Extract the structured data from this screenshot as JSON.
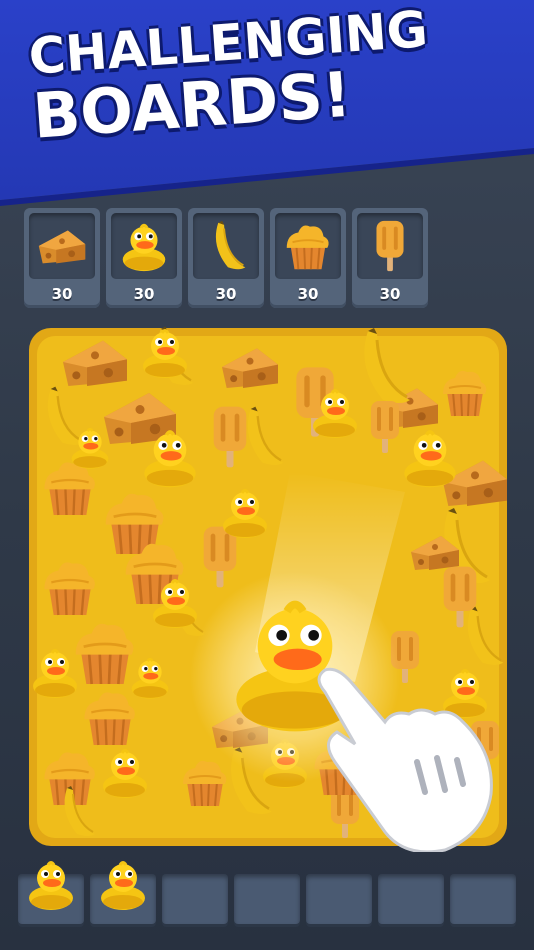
{
  "headline": {
    "line1": "CHALLENGING",
    "line2": "BOARDS!"
  },
  "goals": [
    {
      "item": "cheese-icon",
      "count": "30"
    },
    {
      "item": "duck-icon",
      "count": "30"
    },
    {
      "item": "banana-icon",
      "count": "30"
    },
    {
      "item": "cupcake-icon",
      "count": "30"
    },
    {
      "item": "popsicle-icon",
      "count": "30"
    }
  ],
  "tray": {
    "slots": [
      {
        "item": "duck-icon"
      },
      {
        "item": "duck-icon"
      },
      {
        "item": ""
      },
      {
        "item": ""
      },
      {
        "item": ""
      },
      {
        "item": ""
      },
      {
        "item": ""
      }
    ]
  },
  "colors": {
    "banner": "#2a41c9",
    "background": "#343f50",
    "item_yellow": "#f0c417",
    "item_orange": "#e08b32",
    "duck_beak": "#ff6a1a"
  }
}
